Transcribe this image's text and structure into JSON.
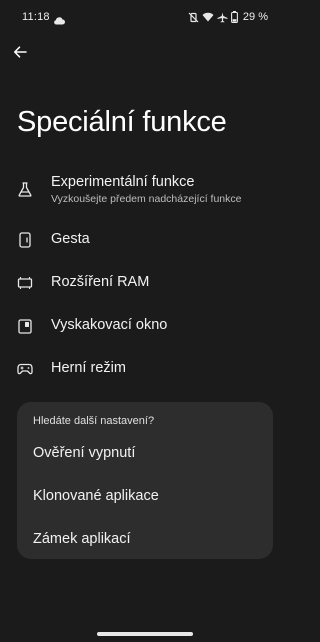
{
  "status_bar": {
    "time": "11:18",
    "battery": "29 %",
    "icons": [
      "cloud-icon",
      "mute-vibrate-icon",
      "wifi-icon",
      "airplane-icon",
      "battery-icon"
    ]
  },
  "header": {
    "back_icon": "arrow-left-icon",
    "title": "Speciální funkce"
  },
  "menu": {
    "items": [
      {
        "label": "Experimentální funkce",
        "sublabel": "Vyzkoušejte předem nadcházející funkce",
        "icon": "flask-icon"
      },
      {
        "label": "Gesta",
        "icon": "phone-gesture-icon"
      },
      {
        "label": "Rozšíření RAM",
        "icon": "memory-chip-icon"
      },
      {
        "label": "Vyskakovací okno",
        "icon": "popup-window-icon"
      },
      {
        "label": "Herní režim",
        "icon": "gamepad-icon"
      }
    ]
  },
  "suggestions": {
    "heading": "Hledáte další nastavení?",
    "items": [
      {
        "label": "Ověření vypnutí"
      },
      {
        "label": "Klonované aplikace"
      },
      {
        "label": "Zámek aplikací"
      }
    ]
  },
  "colors": {
    "background": "#1b1b1b",
    "card": "#2d2d2d",
    "text": "#ffffff",
    "secondary_text": "#bdbdbd"
  }
}
